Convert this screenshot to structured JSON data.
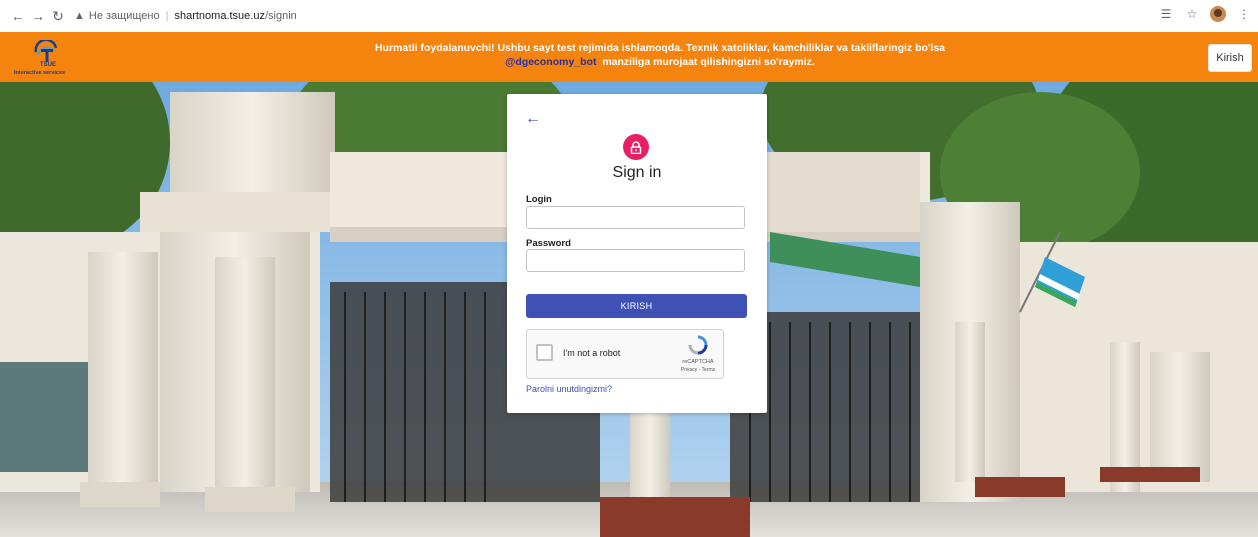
{
  "browser": {
    "security_label": "Не защищено",
    "domain": "shartnoma.tsue.uz",
    "path": "/signin"
  },
  "header": {
    "logo_line1": "TSUE",
    "logo_line2": "Interactive services",
    "notice_line1": "Hurmatli foydalanuvchi! Ushbu sayt test rejimida ishlamoqda. Texnik xatoliklar, kamchiliklar va takliflaringiz bo'lsa",
    "notice_handle": "@dgeconomy_bot",
    "notice_line2": "manziliga murojaat qilishingizni so'raymiz.",
    "kirish_label": "Kirish",
    "background_color": "#f4840d"
  },
  "signin": {
    "title": "Sign in",
    "login_label": "Login",
    "login_value": "",
    "password_label": "Password",
    "password_value": "",
    "submit_label": "KIRISH",
    "captcha_label": "I'm not a robot",
    "captcha_brand": "reCAPTCHA",
    "captcha_links": "Privacy - Terms",
    "forgot_link": "Parolni unutdingizmi?",
    "accent_color": "#3f51b5",
    "lock_badge_color": "#e91e63"
  },
  "icons": {
    "back": "arrow-left-icon",
    "lock": "lock-icon",
    "reload": "reload-icon",
    "star": "star-icon",
    "translate": "translate-icon"
  }
}
